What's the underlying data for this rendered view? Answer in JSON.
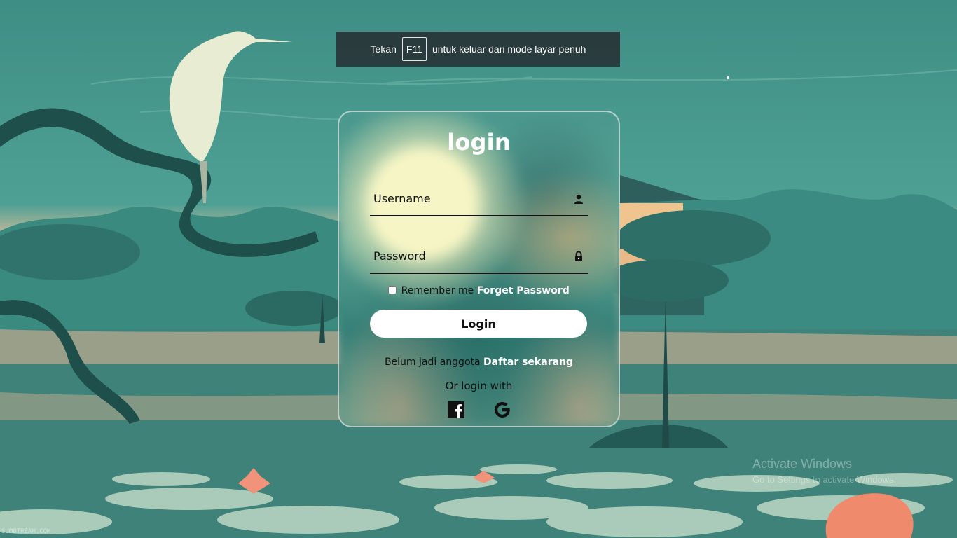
{
  "fullscreen_toast": {
    "prefix": "Tekan",
    "key": "F11",
    "suffix": "untuk keluar dari mode layar penuh"
  },
  "login": {
    "title": "login",
    "username_placeholder": "Username",
    "password_placeholder": "Password",
    "username_icon": "user-icon",
    "password_icon": "lock-icon",
    "remember_label": "Remember me",
    "forgot_link": "Forget Password",
    "submit_label": "Login",
    "register_prompt": "Belum jadi anggota",
    "register_link": "Daftar sekarang",
    "social_prompt": "Or login with",
    "social_icons": [
      "facebook-icon",
      "google-icon"
    ]
  },
  "os_watermark": {
    "line1": "Activate Windows",
    "line2": "Go to Settings to activate Windows."
  },
  "credit": "SUMBTREAM.COM",
  "colors": {
    "sky": "#3f8f86",
    "toast_bg": "#283437",
    "button_bg": "#ffffff",
    "link": "#ffffff"
  }
}
